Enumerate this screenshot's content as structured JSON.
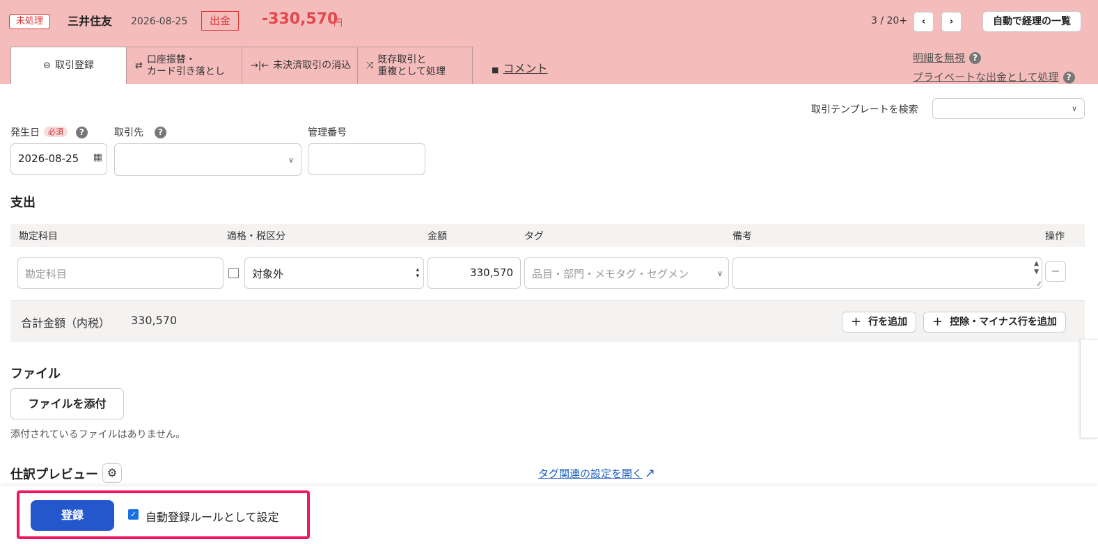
{
  "header": {
    "status": "未処理",
    "bank": "三井住友",
    "date": "2026-08-25",
    "kind": "出金",
    "amount": "-330,570",
    "currency": "円",
    "pager": "3 / 20+",
    "prev_icon": "‹",
    "next_icon": "›",
    "list_button": "自動で経理の一覧",
    "ignore_link": "明細を無視",
    "private_link": "プライベートな出金として処理",
    "help_icon": "?"
  },
  "tabs": [
    {
      "icon": "⊖",
      "line1": "取引登録",
      "line2": ""
    },
    {
      "icon": "⇄",
      "line1": "口座振替・",
      "line2": "カード引き落とし"
    },
    {
      "icon": "→|←",
      "line1": "未決済取引の消込",
      "line2": ""
    },
    {
      "icon": "⤨",
      "line1": "既存取引と",
      "line2": "重複として処理"
    }
  ],
  "comment": {
    "icon": "■",
    "label": "コメント"
  },
  "template_search": {
    "label": "取引テンプレートを検索",
    "value": ""
  },
  "form": {
    "date_label": "発生日",
    "required": "必須",
    "date_value": "2026-08-25",
    "partner_label": "取引先",
    "partner_value": "",
    "mgmt_label": "管理番号",
    "mgmt_value": ""
  },
  "expense": {
    "title": "支出",
    "columns": [
      "勘定科目",
      "適格・税区分",
      "金額",
      "タグ",
      "備考",
      "操作"
    ],
    "row": {
      "account_placeholder": "勘定科目",
      "tax": "対象外",
      "amount": "330,570",
      "tag_placeholder": "品目・部門・メモタグ・セグメン",
      "memo": "",
      "remove": "−"
    },
    "total_label": "合計金額（内税）",
    "total_value": "330,570",
    "add_row": "行を追加",
    "add_minus_row": "控除・マイナス行を追加"
  },
  "file": {
    "title": "ファイル",
    "attach_button": "ファイルを添付",
    "empty_text": "添付されているファイルはありません。"
  },
  "preview": {
    "title": "仕訳プレビュー",
    "tag_link": "タグ関連の設定を開く"
  },
  "footer": {
    "submit": "登録",
    "auto_rule": "自動登録ルールとして設定",
    "auto_rule_checked": true
  },
  "colors": {
    "header_bg": "#f5bcbc",
    "accent_red": "#e3484d",
    "primary_blue": "#2557cc",
    "highlight": "#f0195d"
  }
}
